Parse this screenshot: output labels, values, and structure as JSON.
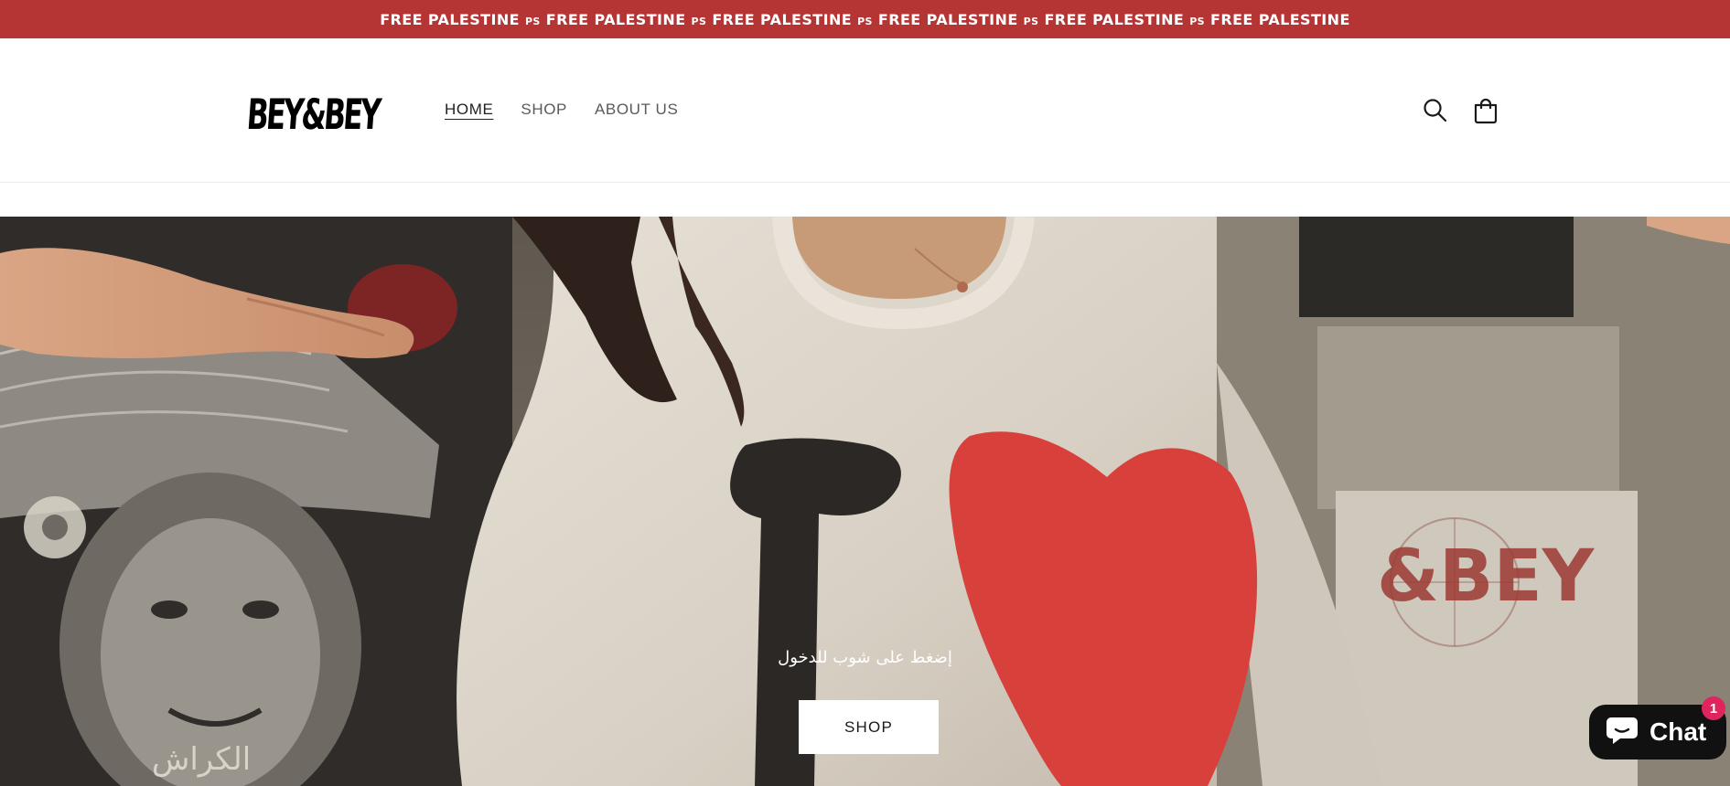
{
  "announcement": {
    "segments": [
      "FREE PALESTINE",
      "FREE PALESTINE",
      "FREE PALESTINE",
      "FREE PALESTINE",
      "FREE PALESTINE",
      "FREE PALESTINE"
    ],
    "separator": "PS",
    "background_color": "#b53434"
  },
  "header": {
    "logo_text": "BEY&BEY",
    "nav": [
      {
        "label": "HOME",
        "active": true
      },
      {
        "label": "SHOP",
        "active": false
      },
      {
        "label": "ABOUT US",
        "active": false
      }
    ],
    "icons": {
      "search": "search-icon",
      "cart": "cart-icon"
    }
  },
  "hero": {
    "subtitle": "إضغط على شوب للدخول",
    "button_label": "SHOP",
    "shirt_text": "I",
    "poster_text": "الكراش",
    "poster_brand": "&BEY",
    "heart_color": "#d8403c"
  },
  "chat": {
    "label": "Chat",
    "badge": "1",
    "icon": "chat-bubble-icon"
  }
}
